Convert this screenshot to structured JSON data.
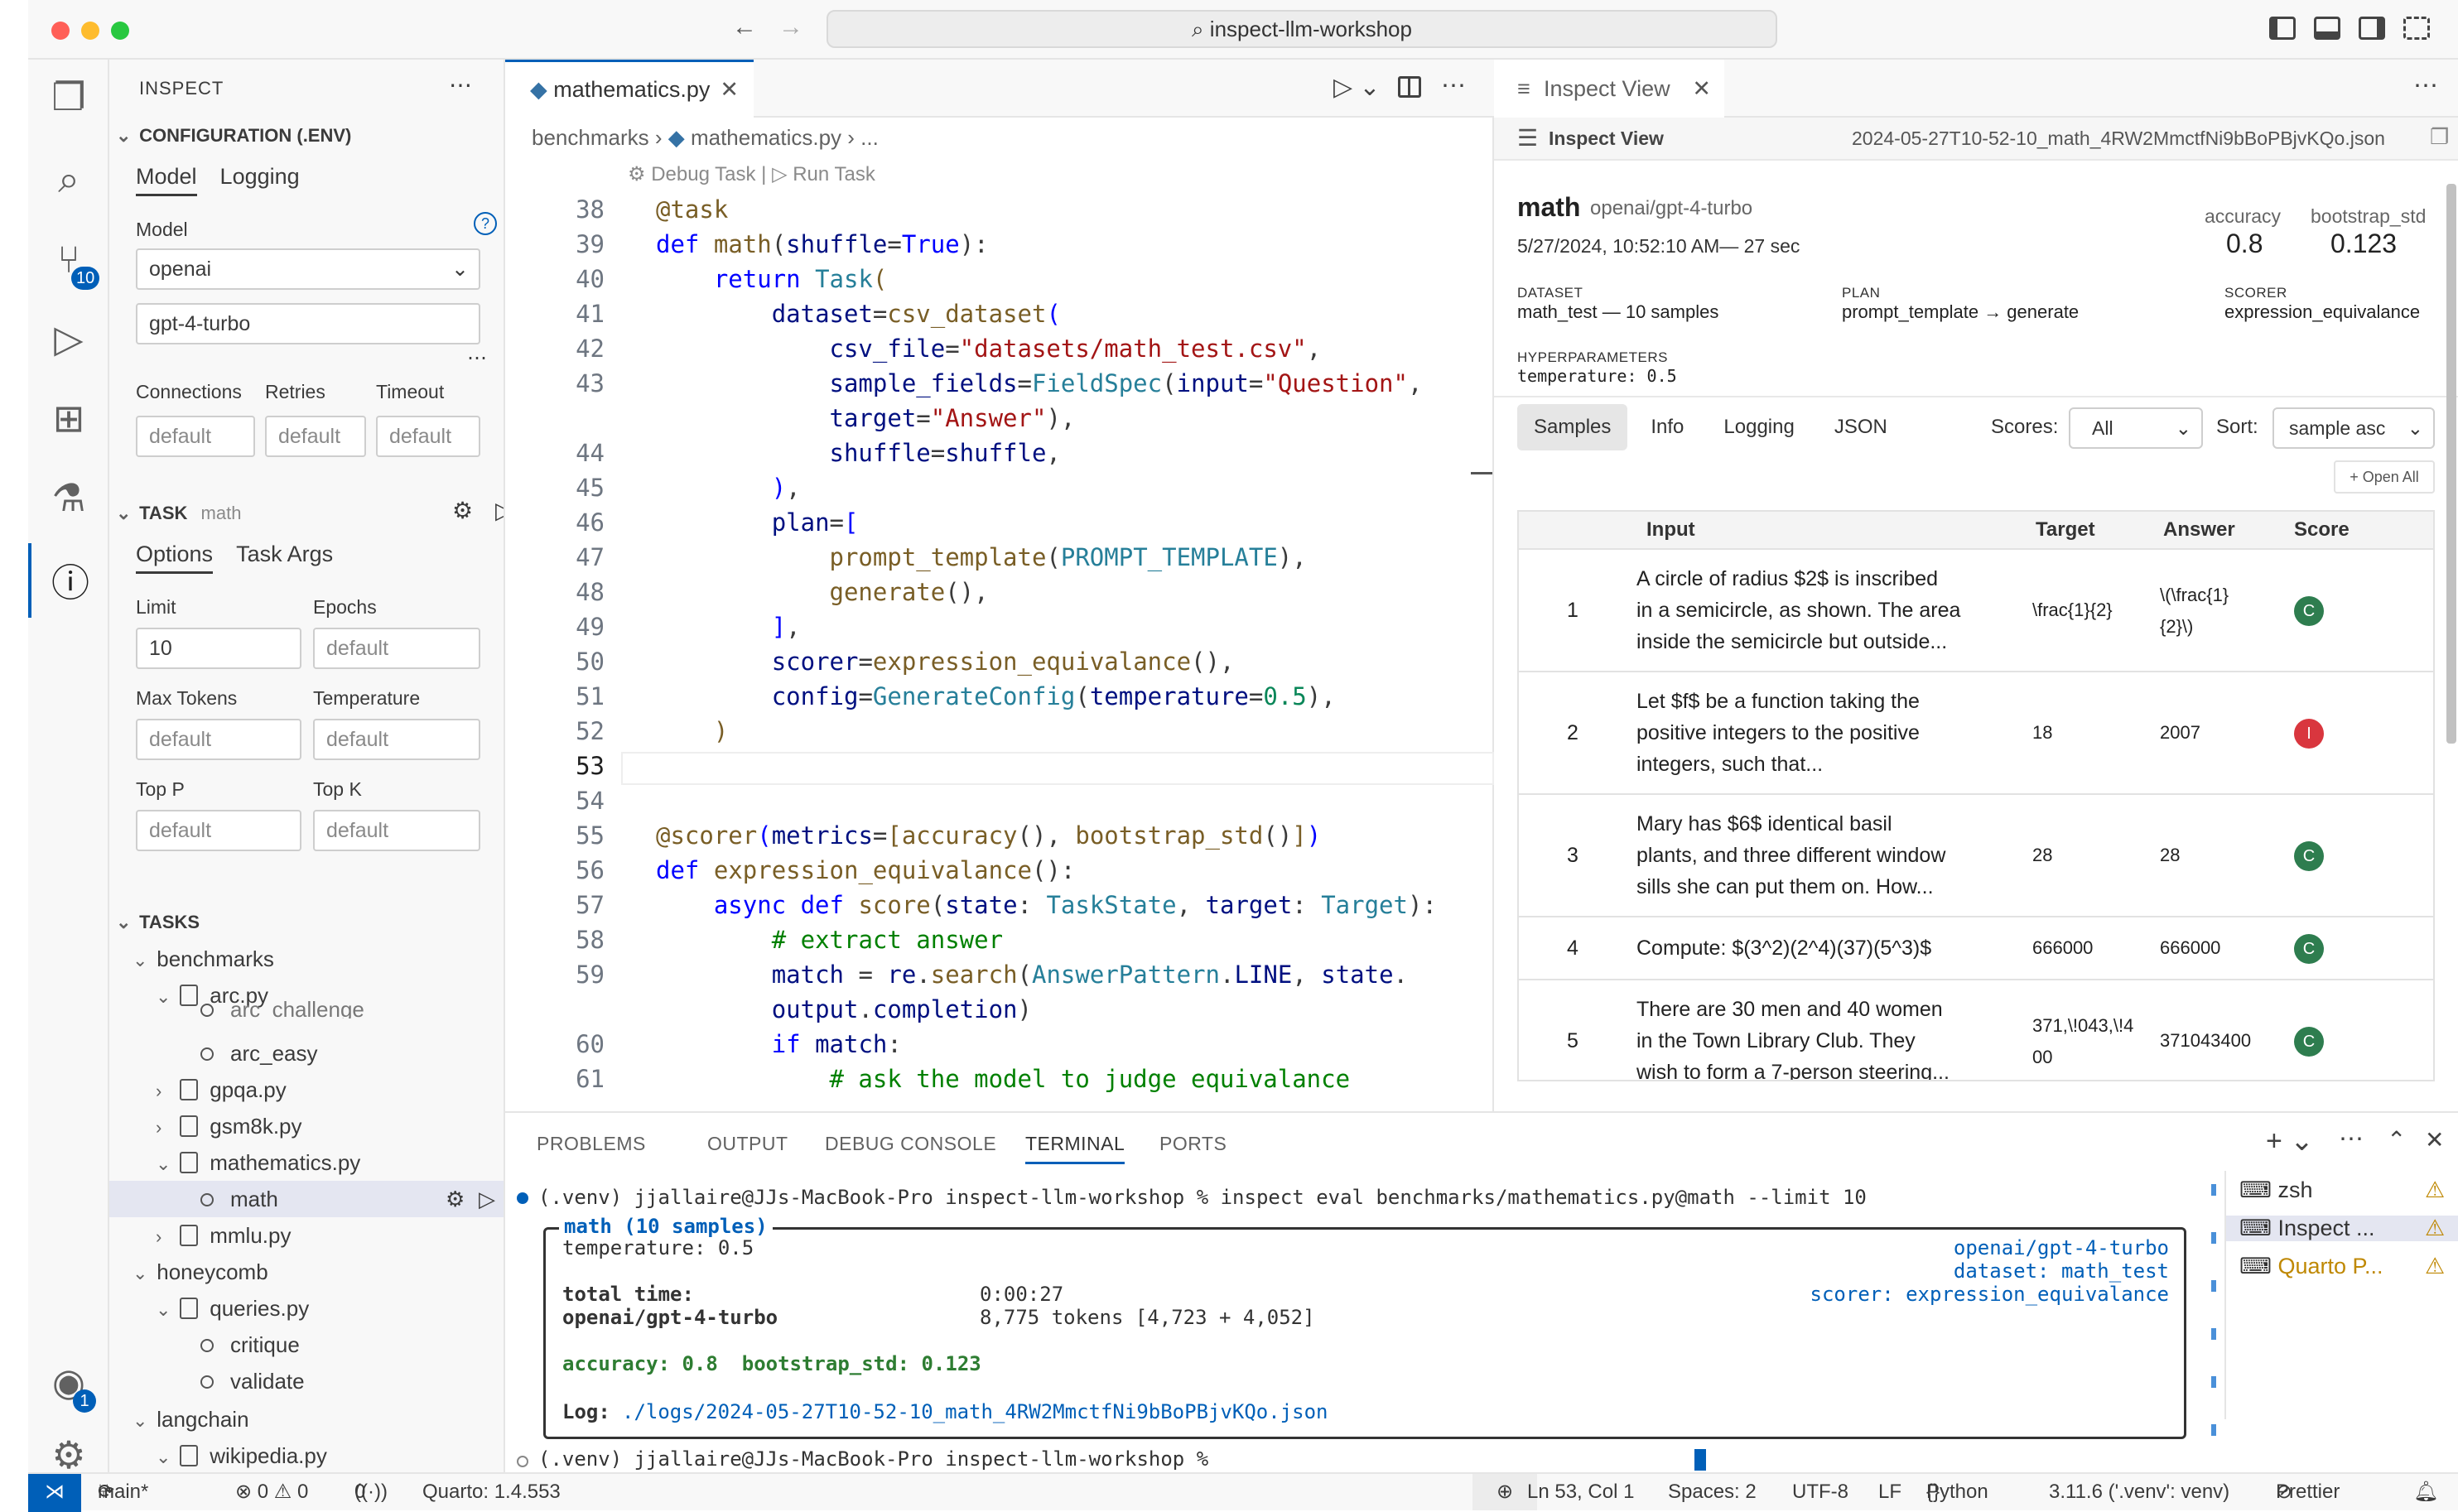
{
  "window": {
    "search": "inspect-llm-workshop"
  },
  "activity": {
    "scm_badge": "10",
    "account_badge": "1"
  },
  "sidebar": {
    "title": "INSPECT",
    "config": {
      "header": "CONFIGURATION (.ENV)",
      "tabs": [
        "Model",
        "Logging"
      ],
      "model_label": "Model",
      "provider": "openai",
      "model": "gpt-4-turbo",
      "connections_label": "Connections",
      "retries_label": "Retries",
      "timeout_label": "Timeout",
      "connections": "default",
      "retries": "default",
      "timeout": "default"
    },
    "task": {
      "header": "TASK",
      "name": "math",
      "tabs": [
        "Options",
        "Task Args"
      ],
      "limit_label": "Limit",
      "limit": "10",
      "epochs_label": "Epochs",
      "epochs": "default",
      "max_tokens_label": "Max Tokens",
      "max_tokens": "default",
      "temperature_label": "Temperature",
      "temperature": "default",
      "top_p_label": "Top P",
      "top_p": "default",
      "top_k_label": "Top K",
      "top_k": "default"
    },
    "tasks": {
      "header": "TASKS",
      "items": [
        "benchmarks",
        "arc.py",
        "arc_challenge",
        "arc_easy",
        "gpqa.py",
        "gsm8k.py",
        "mathematics.py",
        "math",
        "mmlu.py",
        "honeycomb",
        "queries.py",
        "critique",
        "validate",
        "langchain",
        "wikipedia.py"
      ]
    }
  },
  "editor": {
    "tab": "mathematics.py",
    "breadcrumb": [
      "benchmarks",
      "mathematics.py",
      "..."
    ],
    "codelens_debug": "Debug Task |",
    "codelens_run": "Run Task"
  },
  "inspect_view": {
    "tab": "Inspect View",
    "header": "Inspect View",
    "file": "2024-05-27T10-52-10_math_4RW2MmctfNi9bBoPBjvKQo.json",
    "task": "math",
    "model": "openai/gpt-4-turbo",
    "datetime": "5/27/2024, 10:52:10 AM— 27 sec",
    "accuracy_label": "accuracy",
    "accuracy": "0.8",
    "bootstrap_label": "bootstrap_std",
    "bootstrap": "0.123",
    "dataset_label": "DATASET",
    "dataset": "math_test — 10 samples",
    "plan_label": "PLAN",
    "plan": "prompt_template → generate",
    "scorer_label": "SCORER",
    "scorer": "expression_equivalance",
    "hyper_label": "HYPERPARAMETERS",
    "hyper": "temperature: 0.5",
    "tabs": [
      "Samples",
      "Info",
      "Logging",
      "JSON"
    ],
    "scores_label": "Scores:",
    "scores_value": "All",
    "sort_label": "Sort:",
    "sort_value": "sample asc",
    "open_all": "Open All",
    "columns": [
      "Input",
      "Target",
      "Answer",
      "Score"
    ],
    "rows": [
      {
        "id": "1",
        "input": [
          "A circle of radius $2$ is inscribed",
          "in a semicircle, as shown. The area",
          "inside the semicircle but outside..."
        ],
        "target": "\\frac{1}{2}",
        "answer": [
          "\\(\\frac{1}",
          "{2}\\)"
        ],
        "score": "C",
        "color": "#2e7d4f"
      },
      {
        "id": "2",
        "input": [
          "Let $f$ be a function taking the",
          "positive integers to the positive",
          "integers, such that..."
        ],
        "target": "18",
        "answer": [
          "2007"
        ],
        "score": "I",
        "color": "#d9363e"
      },
      {
        "id": "3",
        "input": [
          "Mary has $6$ identical basil",
          "plants, and three different window",
          "sills she can put them on. How..."
        ],
        "target": "28",
        "answer": [
          "28"
        ],
        "score": "C",
        "color": "#2e7d4f"
      },
      {
        "id": "4",
        "input": [
          "Compute: $(3^2)(2^4)(37)(5^3)$"
        ],
        "target": "666000",
        "answer": [
          "666000"
        ],
        "score": "C",
        "color": "#2e7d4f"
      },
      {
        "id": "5",
        "input": [
          "There are 30 men and 40 women",
          "in the Town Library Club. They",
          "wish to form a 7-person steering..."
        ],
        "target": "371,\\!043,\\!400",
        "answer": [
          "371043400"
        ],
        "score": "C",
        "color": "#2e7d4f"
      }
    ]
  },
  "panel": {
    "tabs": [
      "PROBLEMS",
      "OUTPUT",
      "DEBUG CONSOLE",
      "TERMINAL",
      "PORTS"
    ],
    "prompt_cmd": "(.venv) jjallaire@JJs-MacBook-Pro inspect-llm-workshop % inspect eval benchmarks/mathematics.py@math --limit 10",
    "box_title": "math (10 samples)",
    "temperature": "temperature: 0.5",
    "total_time_label": "total time:",
    "total_time": "0:00:27",
    "model_line": "openai/gpt-4-turbo",
    "tokens": "8,775 tokens [4,723 + 4,052]",
    "right1": "openai/gpt-4-turbo",
    "right2": "dataset: math_test",
    "right3": "scorer: expression_equivalance",
    "results": "accuracy: 0.8  bootstrap_std: 0.123",
    "log_label": "Log:",
    "log_path": "./logs/2024-05-27T10-52-10_math_4RW2MmctfNi9bBoPBjvKQo.json",
    "prompt2": "(.venv) jjallaire@JJs-MacBook-Pro inspect-llm-workshop % ",
    "terminals": [
      "zsh",
      "Inspect ...",
      "Quarto P..."
    ]
  },
  "status": {
    "branch": "main*",
    "errors": "⊗ 0 ⚠ 0",
    "ports": "0",
    "quarto": "Quarto: 1.4.553",
    "position": "Ln 53, Col 1",
    "spaces": "Spaces: 2",
    "encoding": "UTF-8",
    "eol": "LF",
    "language": "Python",
    "interpreter": "3.11.6 ('.venv': venv)",
    "prettier": "Prettier"
  }
}
